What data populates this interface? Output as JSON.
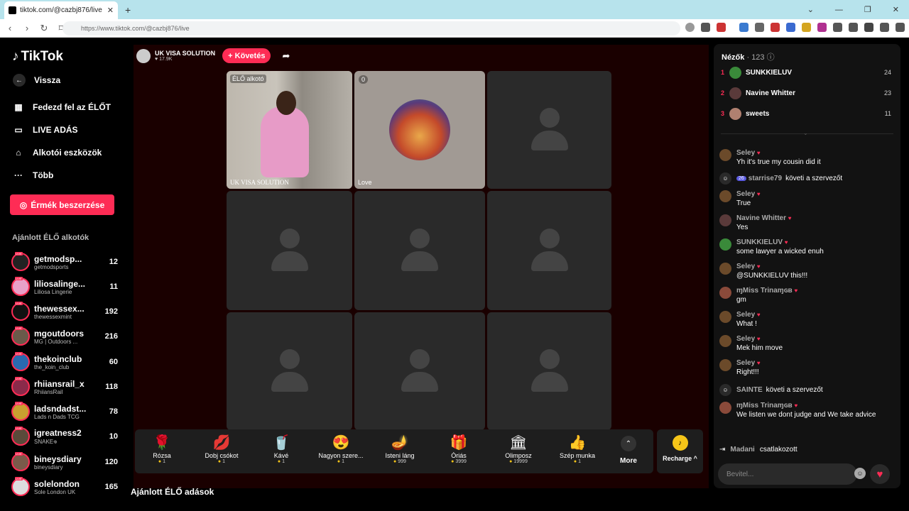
{
  "browser": {
    "tab_title": "tiktok.com/@cazbj876/live",
    "url": "https://www.tiktok.com/@cazbj876/live",
    "close_symbol": "✕",
    "new_tab_symbol": "+"
  },
  "sidebar": {
    "logo": "TikTok",
    "back": "Vissza",
    "items": [
      {
        "label": "Fedezd fel az ÉLŐT",
        "icon": "calendar-icon"
      },
      {
        "label": "LIVE ADÁS",
        "icon": "camera-icon"
      },
      {
        "label": "Alkotói eszközök",
        "icon": "tools-icon"
      },
      {
        "label": "Több",
        "icon": "more-dots-icon"
      }
    ],
    "coins_button": "Érmék beszerzése",
    "recommended_title": "Ajánlott ÉLŐ alkotók",
    "creators": [
      {
        "name": "getmodsp...",
        "sub": "getmodsports",
        "count": "12"
      },
      {
        "name": "liliosalinge...",
        "sub": "Liliosa Lingerie",
        "count": "11"
      },
      {
        "name": "thewessex...",
        "sub": "thewessexmint",
        "count": "192"
      },
      {
        "name": "mgoutdoors",
        "sub": "MG | Outdoors ...",
        "count": "216"
      },
      {
        "name": "thekoinclub",
        "sub": "the_koin_club",
        "count": "60"
      },
      {
        "name": "rhiiansrail_x",
        "sub": "RhiiansRail",
        "count": "118"
      },
      {
        "name": "ladsndadst...",
        "sub": "Lads n Dads TCG",
        "count": "78"
      },
      {
        "name": "igreatness2",
        "sub": "SNAKE𖦹",
        "count": "10"
      },
      {
        "name": "bineysdiary",
        "sub": "bineysdiary",
        "count": "120"
      },
      {
        "name": "solelondon",
        "sub": "Sole London UK",
        "count": "165"
      }
    ]
  },
  "host": {
    "name": "UK VISA SOLUTION",
    "likes": "♥ 17.9K",
    "follow": "+ Követés"
  },
  "stage": {
    "creator_tag": "ÉLŐ alkotó",
    "creator_caption": "UK VISA SOLUTION",
    "guest_badge": "0",
    "guest_caption": "Love"
  },
  "gifts": [
    {
      "name": "Rózsa",
      "price": "1",
      "icon": "🌹"
    },
    {
      "name": "Dobj csókot",
      "price": "1",
      "icon": "💋"
    },
    {
      "name": "Kávé",
      "price": "1",
      "icon": "🥤"
    },
    {
      "name": "Nagyon szere...",
      "price": "1",
      "icon": "😍"
    },
    {
      "name": "Isteni láng",
      "price": "999",
      "icon": "🪔"
    },
    {
      "name": "Óriás",
      "price": "3999",
      "icon": "🎁"
    },
    {
      "name": "Olimposz",
      "price": "19999",
      "icon": "🏛"
    },
    {
      "name": "Szép munka",
      "price": "1",
      "icon": "👍"
    }
  ],
  "more_label": "More",
  "recharge_label": "Recharge ^",
  "recommended_live": "Ajánlott ÉLŐ adások",
  "chat": {
    "viewers_title": "Nézők",
    "viewers_count": "· 123",
    "top_viewers": [
      {
        "rank": "1",
        "name": "SUNKKIELUV",
        "count": "24"
      },
      {
        "rank": "2",
        "name": "Navine Whitter",
        "count": "23"
      },
      {
        "rank": "3",
        "name": "sweets",
        "count": "11"
      }
    ],
    "messages": [
      {
        "name": "Seley",
        "text": "Yh it's true my cousin did it"
      },
      {
        "name": "Seley",
        "text": "True"
      },
      {
        "name": "Navine Whitter",
        "text": "Yes"
      },
      {
        "name": "SUNKKIELUV",
        "text": "some lawyer a wicked enuh"
      },
      {
        "name": "Seley",
        "text": "@SUNKKIELUV this!!!"
      },
      {
        "name": "ɱMiss Trinaɱɢʙ",
        "text": "gm"
      },
      {
        "name": "Seley",
        "text": "What !"
      },
      {
        "name": "Seley",
        "text": "Mek him move"
      },
      {
        "name": "Seley",
        "text": "Right!!!"
      },
      {
        "name": "ɱMiss Trinaɱɢʙ",
        "text": "We listen we dont judge and We take advice"
      }
    ],
    "system1": {
      "name": "starrise79",
      "action": "követi a szervezőt",
      "badge": "26"
    },
    "system2": {
      "name": "SAINTE",
      "action": "követi a szervezőt"
    },
    "joined_name": "Madani",
    "joined_action": "csatlakozott",
    "input_placeholder": "Bevitel..."
  }
}
